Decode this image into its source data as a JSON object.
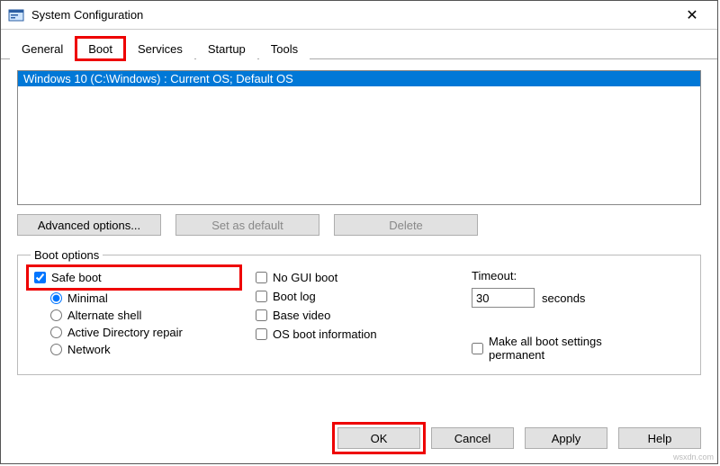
{
  "window": {
    "title": "System Configuration"
  },
  "tabs": {
    "general": "General",
    "boot": "Boot",
    "services": "Services",
    "startup": "Startup",
    "tools": "Tools"
  },
  "oslist": {
    "item0": "Windows 10 (C:\\Windows) : Current OS; Default OS"
  },
  "buttons": {
    "advanced": "Advanced options...",
    "setdefault": "Set as default",
    "delete": "Delete",
    "ok": "OK",
    "cancel": "Cancel",
    "apply": "Apply",
    "help": "Help"
  },
  "boot_options": {
    "legend": "Boot options",
    "safeboot": "Safe boot",
    "minimal": "Minimal",
    "altshell": "Alternate shell",
    "adrepair": "Active Directory repair",
    "network": "Network",
    "nogui": "No GUI boot",
    "bootlog": "Boot log",
    "basevideo": "Base video",
    "osbootinfo": "OS boot information"
  },
  "timeout": {
    "label": "Timeout:",
    "value": "30",
    "unit": "seconds"
  },
  "permanent": "Make all boot settings permanent",
  "watermark": "wsxdn.com"
}
